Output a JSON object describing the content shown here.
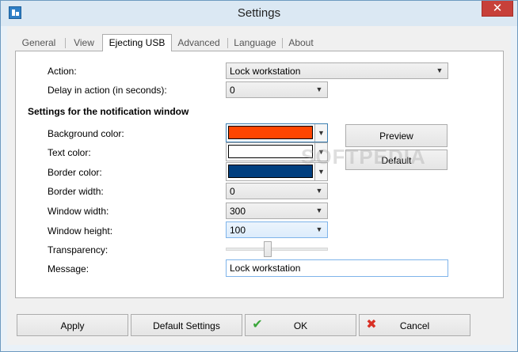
{
  "window": {
    "title": "Settings",
    "close_glyph": "✕"
  },
  "tabs": [
    {
      "label": "General"
    },
    {
      "label": "View"
    },
    {
      "label": "Ejecting USB"
    },
    {
      "label": "Advanced"
    },
    {
      "label": "Language"
    },
    {
      "label": "About"
    }
  ],
  "active_tab": "Ejecting USB",
  "form": {
    "action_label": "Action:",
    "action_value": "Lock workstation",
    "delay_label": "Delay in action (in seconds):",
    "delay_value": "0",
    "notification_heading": "Settings for the notification window",
    "bg_color_label": "Background color:",
    "bg_color": "#ff4500",
    "text_color_label": "Text color:",
    "text_color": "#ffffff",
    "border_color_label": "Border color:",
    "border_color": "#003f7f",
    "border_width_label": "Border width:",
    "border_width_value": "0",
    "window_width_label": "Window width:",
    "window_width_value": "300",
    "window_height_label": "Window height:",
    "window_height_value": "100",
    "transparency_label": "Transparency:",
    "transparency_level": 0.4,
    "message_label": "Message:",
    "message_value": "Lock workstation",
    "preview_label": "Preview",
    "default_label": "Default"
  },
  "watermark": "SOFTPEDIA",
  "buttons": {
    "apply": "Apply",
    "default_settings": "Default Settings",
    "ok": "OK",
    "cancel": "Cancel",
    "ok_icon": "checkmark-icon",
    "cancel_icon": "x-icon",
    "ok_color": "#3aa63a",
    "cancel_color": "#d93025"
  }
}
